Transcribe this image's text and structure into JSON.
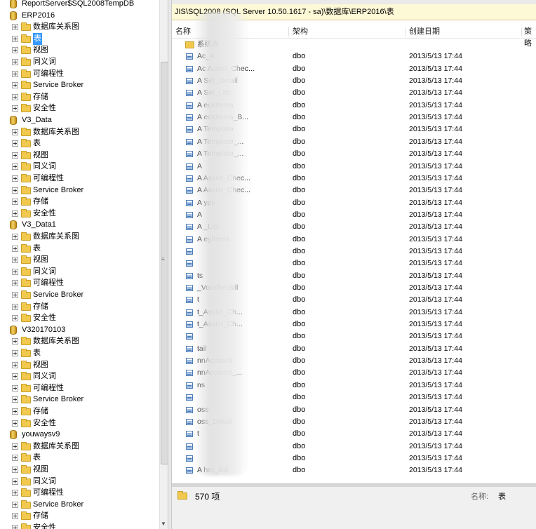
{
  "tree": {
    "top_db": "ReportServer$SQL2008TempDB",
    "databases": [
      {
        "name": "ERP2016"
      },
      {
        "name": "V3_Data"
      },
      {
        "name": "V3_Data1"
      },
      {
        "name": "V320170103"
      },
      {
        "name": "youwaysv9"
      }
    ],
    "folders": [
      "数据库关系图",
      "表",
      "视图",
      "同义词",
      "可编程性",
      "Service Broker",
      "存储",
      "安全性"
    ],
    "selected": "表"
  },
  "path_bar": "JIS\\SQL2008 (SQL Server 10.50.1617 - sa)\\数据库\\ERP2016\\表",
  "columns": {
    "name": "名称",
    "schema": "架构",
    "created": "创建日期",
    "policy": "策略"
  },
  "system_folder": "系统表",
  "rows": [
    {
      "name": "Ac_A",
      "schema": "dbo",
      "date": "2013/5/13 17:44"
    },
    {
      "name": "Ac         Assist_Chec...",
      "schema": "dbo",
      "date": "2013/5/13 17:44"
    },
    {
      "name": "A           Set_Detail",
      "schema": "dbo",
      "date": "2013/5/13 17:44"
    },
    {
      "name": "A           Set_List",
      "schema": "dbo",
      "date": "2013/5/13 17:44"
    },
    {
      "name": "A          eckItems",
      "schema": "dbo",
      "date": "2013/5/13 17:44"
    },
    {
      "name": "A          eckItems_B...",
      "schema": "dbo",
      "date": "2013/5/13 17:44"
    },
    {
      "name": "A           Template",
      "schema": "dbo",
      "date": "2013/5/13 17:44"
    },
    {
      "name": "A           Template_...",
      "schema": "dbo",
      "date": "2013/5/13 17:44"
    },
    {
      "name": "A           Template_...",
      "schema": "dbo",
      "date": "2013/5/13 17:44"
    },
    {
      "name": "A",
      "schema": "dbo",
      "date": "2013/5/13 17:44"
    },
    {
      "name": "A          Assist_Chec...",
      "schema": "dbo",
      "date": "2013/5/13 17:44"
    },
    {
      "name": "A          Assist_Chec...",
      "schema": "dbo",
      "date": "2013/5/13 17:44"
    },
    {
      "name": "A           ype",
      "schema": "dbo",
      "date": "2013/5/13 17:44"
    },
    {
      "name": "A",
      "schema": "dbo",
      "date": "2013/5/13 17:44"
    },
    {
      "name": "A           _List",
      "schema": "dbo",
      "date": "2013/5/13 17:44"
    },
    {
      "name": "A          eyItems",
      "schema": "dbo",
      "date": "2013/5/13 17:44"
    },
    {
      "name": "",
      "schema": "dbo",
      "date": "2013/5/13 17:44"
    },
    {
      "name": "",
      "schema": "dbo",
      "date": "2013/5/13 17:44"
    },
    {
      "name": "         ts",
      "schema": "dbo",
      "date": "2013/5/13 17:44"
    },
    {
      "name": "         _VoucherBill",
      "schema": "dbo",
      "date": "2013/5/13 17:44"
    },
    {
      "name": "         t",
      "schema": "dbo",
      "date": "2013/5/13 17:44"
    },
    {
      "name": "         t_Assist_Ch...",
      "schema": "dbo",
      "date": "2013/5/13 17:44"
    },
    {
      "name": "         t_Assist_Ch...",
      "schema": "dbo",
      "date": "2013/5/13 17:44"
    },
    {
      "name": "",
      "schema": "dbo",
      "date": "2013/5/13 17:44"
    },
    {
      "name": "         tail",
      "schema": "dbo",
      "date": "2013/5/13 17:44"
    },
    {
      "name": "         nnAccount",
      "schema": "dbo",
      "date": "2013/5/13 17:44"
    },
    {
      "name": "         nnAccount_...",
      "schema": "dbo",
      "date": "2013/5/13 17:44"
    },
    {
      "name": "         ns",
      "schema": "dbo",
      "date": "2013/5/13 17:44"
    },
    {
      "name": "",
      "schema": "dbo",
      "date": "2013/5/13 17:44"
    },
    {
      "name": "         oss",
      "schema": "dbo",
      "date": "2013/5/13 17:44"
    },
    {
      "name": "         oss_Detail",
      "schema": "dbo",
      "date": "2013/5/13 17:44"
    },
    {
      "name": "         t",
      "schema": "dbo",
      "date": "2013/5/13 17:44"
    },
    {
      "name": "",
      "schema": "dbo",
      "date": "2013/5/13 17:44"
    },
    {
      "name": "",
      "schema": "dbo",
      "date": "2013/5/13 17:44"
    },
    {
      "name": "A         her_Bill",
      "schema": "dbo",
      "date": "2013/5/13 17:44"
    }
  ],
  "status": {
    "count": "570 项",
    "name_label": "名称:",
    "name_value": "表"
  },
  "colors": {
    "selection": "#3399ff",
    "path_bg": "#fdf8d6"
  }
}
